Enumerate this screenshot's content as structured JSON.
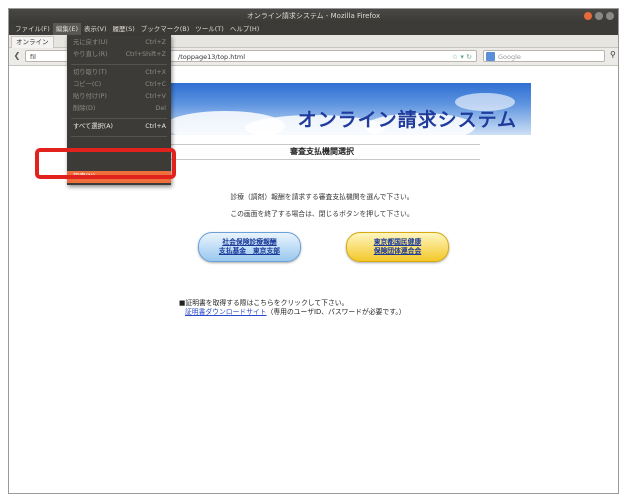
{
  "window": {
    "title": "オンライン請求システム - Mozilla Firefox"
  },
  "menubar": [
    "ファイル(F)",
    "編集(E)",
    "表示(V)",
    "履歴(S)",
    "ブックマーク(B)",
    "ツール(T)",
    "ヘルプ(H)"
  ],
  "tab": {
    "label": "オンライン"
  },
  "nav": {
    "url_prefix": "fil",
    "url_path": "/toppage13/top.html",
    "search_placeholder": "Google"
  },
  "edit_menu": {
    "items": [
      {
        "label": "元に戻す(U)",
        "shortcut": "Ctrl+Z"
      },
      {
        "label": "やり直し(R)",
        "shortcut": "Ctrl+Shift+Z"
      },
      {
        "label": "切り取り(T)",
        "shortcut": "Ctrl+X"
      },
      {
        "label": "コピー(C)",
        "shortcut": "Ctrl+C"
      },
      {
        "label": "貼り付け(P)",
        "shortcut": "Ctrl+V"
      },
      {
        "label": "削除(D)",
        "shortcut": "Del"
      },
      {
        "label": "すべて選択(A)",
        "shortcut": "Ctrl+A"
      },
      {
        "label": "設定(N)",
        "shortcut": ""
      }
    ]
  },
  "page": {
    "banner_title": "オンライン請求システム",
    "heading": "審査支払機関選択",
    "instruction1": "診療（調剤）報酬を請求する審査支払機関を選んで下さい。",
    "instruction2": "この画面を終了する場合は、閉じるボタンを押して下さい。",
    "button_shaho": [
      "社会保険診療報酬",
      "支払基金　東京支部"
    ],
    "button_kokuho": [
      "東京都国民健康",
      "保険団体連合会"
    ],
    "cert_note": "■証明書を取得する際はこちらをクリックして下さい。",
    "cert_link": "証明書ダウンロードサイト",
    "cert_suffix": "（専用のユーザID、パスワードが必要です。）"
  },
  "colors": {
    "menu_highlight": "#ef6f3c",
    "callout": "#e2221d"
  }
}
